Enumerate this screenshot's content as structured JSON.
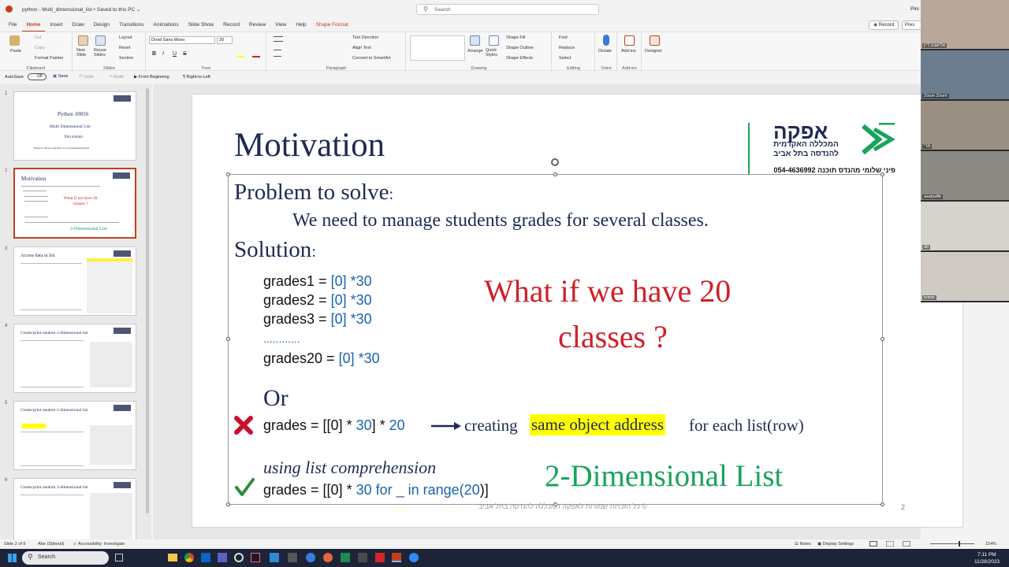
{
  "titlebar": {
    "title": "python - Multi_dimensional_list • Saved to this PC ⌄",
    "search_placeholder": "Search",
    "user": "Pini"
  },
  "tabs": [
    "File",
    "Home",
    "Insert",
    "Draw",
    "Design",
    "Transitions",
    "Animations",
    "Slide Show",
    "Record",
    "Review",
    "View",
    "Help",
    "Shape Format"
  ],
  "top_buttons": {
    "record": "Record",
    "present": "Pres"
  },
  "ribbon": {
    "clipboard": {
      "paste": "Paste",
      "cut": "Cut",
      "copy": "Copy",
      "format_painter": "Format Painter",
      "label": "Clipboard"
    },
    "slides": {
      "new_slide": "New Slide",
      "reuse": "Reuse Slides",
      "layout": "Layout",
      "reset": "Reset",
      "section": "Section",
      "label": "Slides"
    },
    "font": {
      "family": "Droid Sans Mono",
      "size": "20",
      "bold": "B",
      "italic": "I",
      "underline": "U",
      "strike": "S",
      "label": "Font"
    },
    "paragraph": {
      "text_direction": "Text Direction",
      "align_text": "Align Text",
      "smartart": "Convert to SmartArt",
      "label": "Paragraph"
    },
    "drawing": {
      "arrange": "Arrange",
      "quick_styles": "Quick Styles",
      "fill": "Shape Fill",
      "outline": "Shape Outline",
      "effects": "Shape Effects",
      "label": "Drawing"
    },
    "editing": {
      "find": "Find",
      "replace": "Replace",
      "select": "Select",
      "label": "Editing"
    },
    "voice": {
      "dictate": "Dictate",
      "label": "Voice"
    },
    "addins": {
      "addins": "Add-ins",
      "label": "Add-ins"
    },
    "designer": {
      "label": "Designer"
    }
  },
  "qat": {
    "autosave": "AutoSave",
    "off": "Off",
    "save": "Save",
    "undo": "Undo",
    "redo": "Redo",
    "from_beginning": "From Beginning",
    "rtl": "Right-to-Left"
  },
  "thumbnails": [
    {
      "num": "1",
      "title": "Python 10016",
      "lines": [
        "Multi Dimensional List",
        "Pini shlomi",
        "Thanks to Keren and Intro to programming Python"
      ]
    },
    {
      "num": "2",
      "title": "Motivation",
      "accent": "What if we have 20 classes ?",
      "green": "2-Dimensional List"
    },
    {
      "num": "3",
      "title": "Access data in list"
    },
    {
      "num": "4",
      "title": "Create/print random 2-dimensional list"
    },
    {
      "num": "5",
      "title": "Create/print random 2-dimensional list"
    },
    {
      "num": "6",
      "title": "Create/print random 3-dimensional list"
    }
  ],
  "slide": {
    "title": "Motivation",
    "logo_he": "אפקה",
    "logo_sub1": "המכללה האקדמית",
    "logo_sub2": "להנדסה בתל אביב",
    "contact": "פיני שלומי מהנדס תוכנה 054-4636992",
    "problem_label": "Problem to solve",
    "colon": ":",
    "problem_text": "We need to manage students grades for several classes.",
    "solution_label": "Solution",
    "grades": [
      "grades1 = ",
      "grades2 = ",
      "grades3 = "
    ],
    "zero_list": "[0]",
    "times30": " *30",
    "dots": "............",
    "grades20": "grades20 = ",
    "what_if": "What if we have 20",
    "classes": "classes ?",
    "or": "Or",
    "bad_code_a": "grades = [[0] * ",
    "bad_code_30": "30",
    "bad_code_b": "] * ",
    "bad_code_20": "20",
    "creating": "creating",
    "highlight": "same object address",
    "for_each": "for each list(row)",
    "using": "using list comprehension",
    "good_a": "grades = [[0] * ",
    "good_b": "30 for _ in range(",
    "good_c": "20",
    "good_d": ")]",
    "two_dim": "2-Dimensional List",
    "footer": "© כל הזכויות שמורות לאפקה המכללה להנדסה בתל אביב",
    "page_num": "2"
  },
  "status": {
    "slide": "Slide 2 of 6",
    "lang": "Afar (Djibouti)",
    "accessibility": "Accessibility: Investigate",
    "notes": "Notes",
    "display": "Display Settings",
    "zoom": "154%"
  },
  "taskbar": {
    "search": "Search",
    "time": "7:11 PM",
    "date": "11/28/2023"
  },
  "video": [
    {
      "name": "אלישבע דיין",
      "color": "#b9a79a"
    },
    {
      "name": "Zoom Zoom",
      "color": "#6c7d8f"
    },
    {
      "name": "מרי",
      "color": "#9a8f83"
    },
    {
      "name": "asafyaffe",
      "color": "#8c8a84"
    },
    {
      "name": "do",
      "color": "#d6d2cc"
    },
    {
      "name": "tomer",
      "color": "#cfcac4"
    }
  ],
  "colors": {
    "accent": "#c43e1c",
    "title_navy": "#1f2a55",
    "red": "#d0202a",
    "green": "#1aa35b",
    "code_blue": "#1a63b0",
    "highlight": "#ffff00"
  }
}
